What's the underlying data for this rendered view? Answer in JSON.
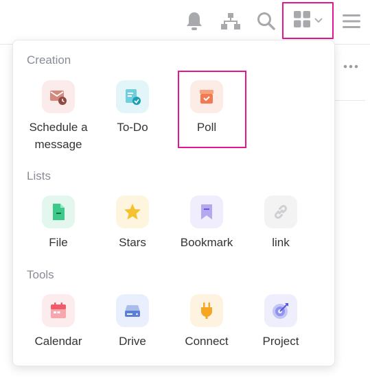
{
  "header": {
    "icons": [
      "bell-icon",
      "sitemap-icon",
      "search-icon",
      "grid-apps-icon",
      "chevron-down-icon",
      "hamburger-menu-icon"
    ]
  },
  "dropdown": {
    "sections": [
      {
        "title": "Creation",
        "items": [
          {
            "label": "Schedule a message",
            "icon": "schedule-message-icon",
            "color": "#c96a5a"
          },
          {
            "label": "To-Do",
            "icon": "todo-icon",
            "color": "#2bb3c8"
          },
          {
            "label": "Poll",
            "icon": "poll-icon",
            "color": "#f07b53"
          }
        ]
      },
      {
        "title": "Lists",
        "items": [
          {
            "label": "File",
            "icon": "file-icon",
            "color": "#3dc98a"
          },
          {
            "label": "Stars",
            "icon": "star-icon",
            "color": "#f5c12e"
          },
          {
            "label": "Bookmark",
            "icon": "bookmark-icon",
            "color": "#8c7ae6"
          },
          {
            "label": "link",
            "icon": "link-icon",
            "color": "#c8c8c8"
          }
        ]
      },
      {
        "title": "Tools",
        "items": [
          {
            "label": "Calendar",
            "icon": "calendar-icon",
            "color": "#ef5b6b"
          },
          {
            "label": "Drive",
            "icon": "drive-icon",
            "color": "#5b7fd6"
          },
          {
            "label": "Connect",
            "icon": "plug-icon",
            "color": "#f5a623"
          },
          {
            "label": "Project",
            "icon": "target-icon",
            "color": "#6b6ee8"
          }
        ]
      }
    ]
  },
  "highlight_color": "#e4168f"
}
